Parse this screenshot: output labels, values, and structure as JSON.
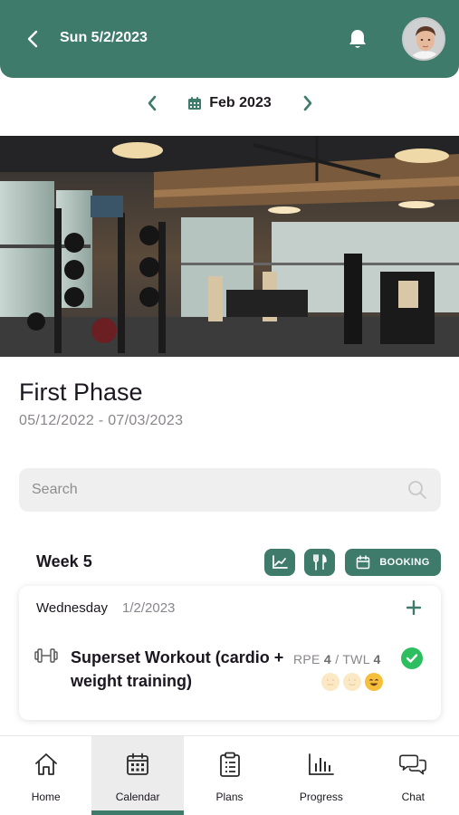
{
  "header": {
    "date": "Sun 5/2/2023",
    "back_icon": "chevron-left-icon",
    "bell_icon": "bell-icon",
    "accent_color": "#3e7b6b"
  },
  "month_nav": {
    "label": "Feb 2023",
    "calendar_icon": "calendar-icon"
  },
  "phase": {
    "title": "First Phase",
    "dates": "05/12/2022 - 07/03/2023"
  },
  "search": {
    "placeholder": "Search",
    "value": ""
  },
  "week": {
    "label": "Week 5",
    "booking_label": "BOOKING"
  },
  "day_card": {
    "day_name": "Wednesday",
    "date": "1/2/2023",
    "workout": {
      "title": "Superset Workout (cardio + weight training)",
      "rpe_label": "RPE",
      "rpe_value": "4",
      "twl_label": "TWL",
      "twl_value": "4",
      "completed": true,
      "mood_level": 3,
      "mood_max": 3
    }
  },
  "bottom_nav": {
    "items": [
      {
        "label": "Home",
        "icon": "home-icon"
      },
      {
        "label": "Calendar",
        "icon": "calendar-icon"
      },
      {
        "label": "Plans",
        "icon": "clipboard-icon"
      },
      {
        "label": "Progress",
        "icon": "bar-chart-icon"
      },
      {
        "label": "Chat",
        "icon": "chat-icon"
      }
    ],
    "active": "Calendar"
  }
}
